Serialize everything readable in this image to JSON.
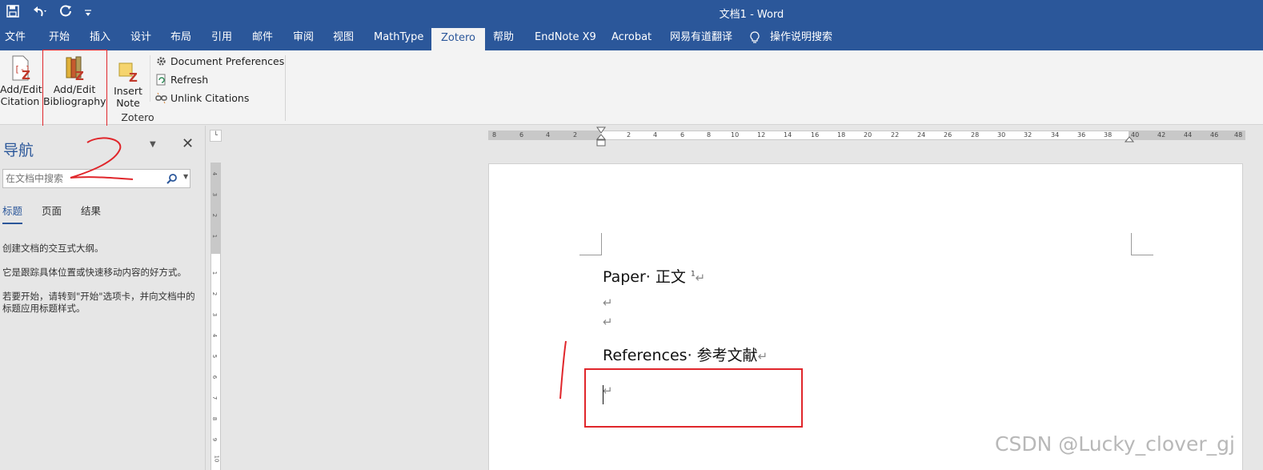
{
  "window": {
    "title": "文档1  -  Word"
  },
  "qat": {
    "save_icon": "save-icon",
    "undo_icon": "undo-icon",
    "redo_icon": "redo-icon",
    "customize_icon": "customize-icon"
  },
  "tabs": [
    {
      "label": "文件"
    },
    {
      "label": "开始"
    },
    {
      "label": "插入"
    },
    {
      "label": "设计"
    },
    {
      "label": "布局"
    },
    {
      "label": "引用"
    },
    {
      "label": "邮件"
    },
    {
      "label": "审阅"
    },
    {
      "label": "视图"
    },
    {
      "label": "MathType"
    },
    {
      "label": "Zotero"
    },
    {
      "label": "帮助"
    },
    {
      "label": "EndNote X9"
    },
    {
      "label": "Acrobat"
    },
    {
      "label": "网易有道翻译"
    },
    {
      "label": "操作说明搜索"
    }
  ],
  "ribbon": {
    "add_edit_citation": {
      "line1": "Add/Edit",
      "line2": "Citation"
    },
    "add_edit_bibliography": {
      "line1": "Add/Edit",
      "line2": "Bibliography"
    },
    "insert_note": {
      "line1": "Insert",
      "line2": "Note"
    },
    "document_preferences": "Document Preferences",
    "refresh": "Refresh",
    "unlink_citations": "Unlink Citations",
    "group_label": "Zotero"
  },
  "nav": {
    "title": "导航",
    "search_placeholder": "在文档中搜索",
    "tabs": [
      "标题",
      "页面",
      "结果"
    ],
    "text1": "创建文档的交互式大纲。",
    "text2": "它是跟踪具体位置或快速移动内容的好方式。",
    "text3": "若要开始，请转到\"开始\"选项卡，并向文档中的标题应用标题样式。"
  },
  "ruler": {
    "h_ticks": [
      "8",
      "6",
      "4",
      "2",
      "2",
      "4",
      "6",
      "8",
      "10",
      "12",
      "14",
      "16",
      "18",
      "20",
      "22",
      "24",
      "26",
      "28",
      "30",
      "32",
      "34",
      "36",
      "38",
      "40",
      "42",
      "44",
      "46",
      "48"
    ],
    "v_ticks": [
      "4",
      "3",
      "2",
      "1",
      "1",
      "2",
      "3",
      "4",
      "5",
      "6",
      "7",
      "8",
      "9",
      "10"
    ]
  },
  "document": {
    "line1": "Paper· 正文",
    "line1_sup": "1",
    "return_mark": "↵",
    "line4": "References· 参考文献"
  },
  "watermark": "CSDN @Lucky_clover_gj",
  "colors": {
    "word_blue": "#2b579a",
    "annotation_red": "#e0262b"
  }
}
